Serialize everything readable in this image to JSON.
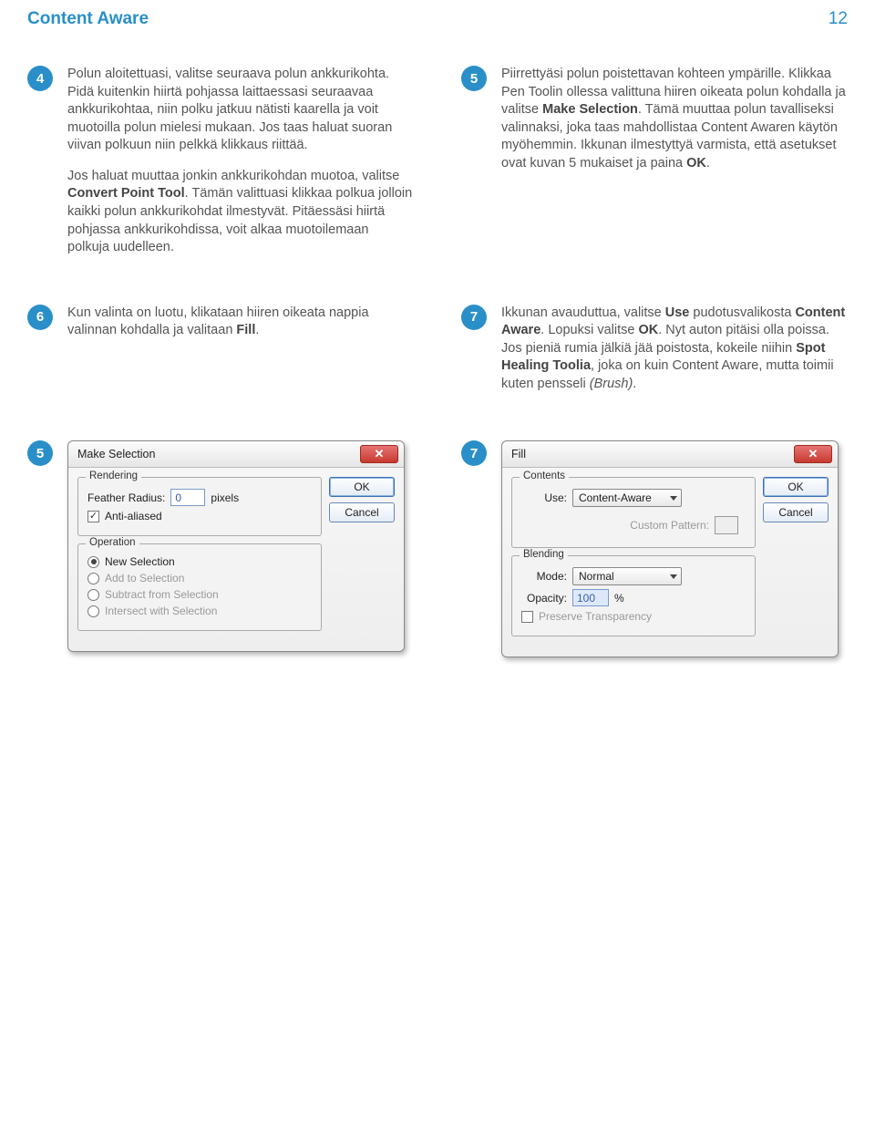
{
  "header": {
    "title": "Content Aware",
    "page": "12"
  },
  "steps": {
    "s4": {
      "num": "4",
      "p1a": "Polun aloitettuasi, valitse seuraava polun ankkurikohta. Pidä kuitenkin hiirtä pohjassa laittaessasi seuraavaa ankkurikohtaa, niin polku jatkuu nätisti kaarella ja voit muotoilla polun mielesi mukaan. Jos taas haluat suoran viivan polkuun niin pelkkä klikkaus riittää.",
      "p2a": "Jos haluat muuttaa jonkin ankkurikohdan muotoa, valitse ",
      "p2b": "Convert Point Tool",
      "p2c": ". Tämän valittuasi klikkaa polkua jolloin kaikki polun ankkurikohdat ilmestyvät. Pitäessäsi hiirtä pohjassa ankkurikohdissa, voit alkaa muotoilemaan polkuja uudelleen."
    },
    "s5": {
      "num": "5",
      "p1a": "Piirrettyäsi polun poistettavan kohteen ympärille. Klikkaa Pen Toolin ollessa valittuna hiiren oikeata polun kohdalla ja valitse ",
      "p1b": "Make Selection",
      "p1c": ". Tämä muuttaa polun tavalliseksi valinnaksi, joka taas mahdollistaa Content Awaren käytön myöhemmin. Ikkunan ilmestyttyä varmista, että asetukset ovat kuvan 5 mukaiset ja paina ",
      "p1d": "OK",
      "p1e": "."
    },
    "s6": {
      "num": "6",
      "p1a": "Kun valinta on luotu, klikataan hiiren oikeata nappia valinnan kohdalla ja valitaan ",
      "p1b": "Fill",
      "p1c": "."
    },
    "s7": {
      "num": "7",
      "p1a": "Ikkunan avauduttua, valitse ",
      "p1b": "Use",
      "p1c": " pudotusvalikosta ",
      "p1d": "Content Aware",
      "p1e": ". Lopuksi valitse ",
      "p1f": "OK",
      "p1g": ". Nyt auton pitäisi olla poissa. Jos pieniä rumia jälkiä jää poistosta, kokeile niihin ",
      "p1h": "Spot Healing Toolia",
      "p1i": ", joka on kuin Content Aware, mutta toimii kuten pensseli ",
      "p1j": "(Brush)",
      "p1k": "."
    }
  },
  "shots": {
    "s5num": "5",
    "s7num": "7"
  },
  "dialog_make_selection": {
    "title": "Make Selection",
    "rendering_label": "Rendering",
    "feather_label": "Feather Radius:",
    "feather_value": "0",
    "pixels": "pixels",
    "antialias": "Anti-aliased",
    "operation_label": "Operation",
    "op_new": "New Selection",
    "op_add": "Add to Selection",
    "op_sub": "Subtract from Selection",
    "op_int": "Intersect with Selection",
    "ok": "OK",
    "cancel": "Cancel"
  },
  "dialog_fill": {
    "title": "Fill",
    "contents_label": "Contents",
    "use_label": "Use:",
    "use_value": "Content-Aware",
    "pattern_label": "Custom Pattern:",
    "blending_label": "Blending",
    "mode_label": "Mode:",
    "mode_value": "Normal",
    "opacity_label": "Opacity:",
    "opacity_value": "100",
    "percent": "%",
    "preserve": "Preserve Transparency",
    "ok": "OK",
    "cancel": "Cancel"
  }
}
